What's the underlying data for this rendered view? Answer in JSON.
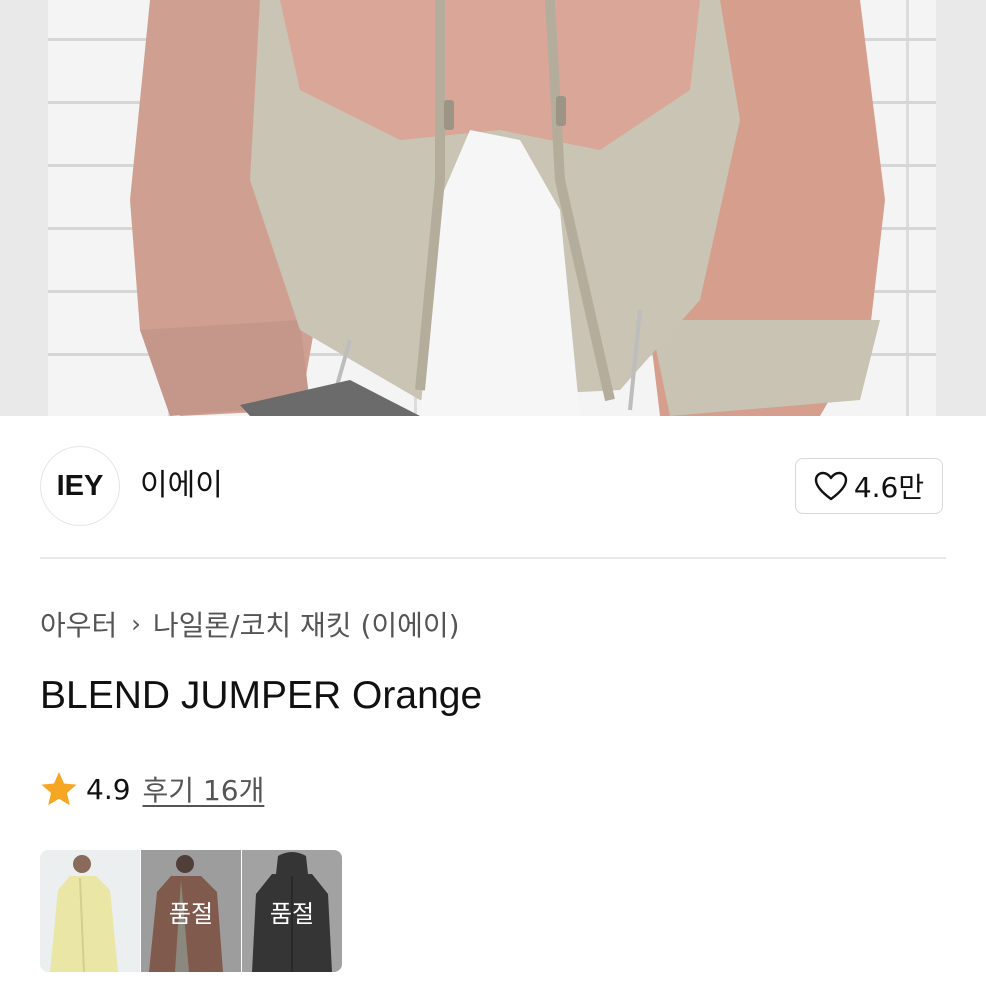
{
  "hero": {
    "image_subject": "product photo: pink and beige two-zip nylon jumper in front of white brick wall",
    "colors": {
      "wall": "#f4f4f4",
      "jacket_pink": "#d8a294",
      "jacket_beige": "#c8c3b2",
      "inner_shirt": "#f6f6f6"
    }
  },
  "brand": {
    "logo_text": "IEY",
    "name": "이에이",
    "like_icon": "heart-outline-icon",
    "like_count": "4.6만"
  },
  "breadcrumb": {
    "category": "아우터",
    "separator_icon": "chevron-right-icon",
    "subcategory": "나일론/코치 재킷 (이에이)"
  },
  "product": {
    "title": "BLEND JUMPER Orange"
  },
  "rating": {
    "star_icon": "star-icon",
    "star_color": "#f5a623",
    "score": "4.9",
    "review_link": "후기 16개"
  },
  "options": [
    {
      "name": "yellow",
      "swatch_color": "#e9e6a6",
      "sold_out_label": ""
    },
    {
      "name": "orange",
      "swatch_color": "#b97a66",
      "sold_out_label": "품절"
    },
    {
      "name": "charcoal",
      "swatch_color": "#3e3e3e",
      "sold_out_label": "품절"
    }
  ]
}
